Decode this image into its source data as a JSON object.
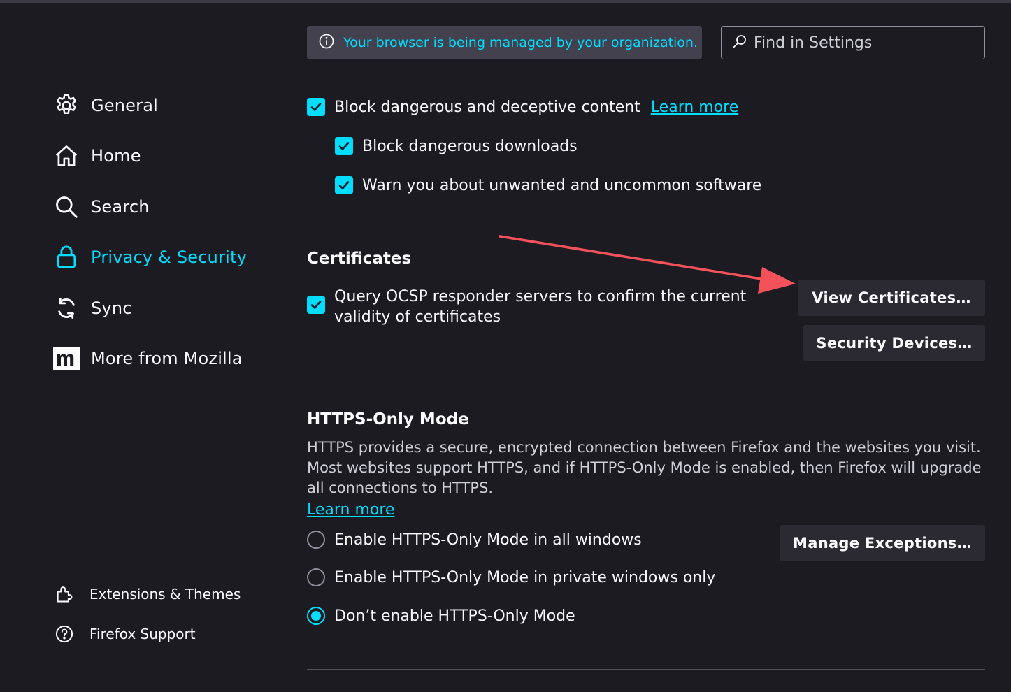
{
  "colors": {
    "background": "#1c1b22",
    "accent": "#00ddff",
    "button": "#2b2a33",
    "arrow": "#f4525a"
  },
  "sidebar": {
    "items": [
      {
        "label": "General",
        "icon": "gear-icon"
      },
      {
        "label": "Home",
        "icon": "home-icon"
      },
      {
        "label": "Search",
        "icon": "search-icon"
      },
      {
        "label": "Privacy & Security",
        "icon": "lock-icon",
        "active": true
      },
      {
        "label": "Sync",
        "icon": "sync-icon"
      },
      {
        "label": "More from Mozilla",
        "icon": "mozilla-icon"
      }
    ],
    "footer": [
      {
        "label": "Extensions & Themes",
        "icon": "puzzle-icon"
      },
      {
        "label": "Firefox Support",
        "icon": "help-icon"
      }
    ]
  },
  "header": {
    "managed_text": "Your browser is being managed by your organization.",
    "search_placeholder": "Find in Settings"
  },
  "deceptive": {
    "block_content": "Block dangerous and deceptive content",
    "learn_more": "Learn more",
    "block_downloads": "Block dangerous downloads",
    "warn_software": "Warn you about unwanted and uncommon software"
  },
  "certificates": {
    "heading": "Certificates",
    "ocsp_line1": "Query OCSP responder servers to confirm the current",
    "ocsp_line2": "validity of certificates",
    "view_button": "View Certificates…",
    "devices_button": "Security Devices…"
  },
  "https_only": {
    "heading": "HTTPS-Only Mode",
    "description": "HTTPS provides a secure, encrypted connection between Firefox and the websites you visit. Most websites support HTTPS, and if HTTPS-Only Mode is enabled, then Firefox will upgrade all connections to HTTPS.",
    "learn_more": "Learn more",
    "manage_button": "Manage Exceptions…",
    "options": [
      {
        "label": "Enable HTTPS-Only Mode in all windows",
        "selected": false
      },
      {
        "label": "Enable HTTPS-Only Mode in private windows only",
        "selected": false
      },
      {
        "label": "Don’t enable HTTPS-Only Mode",
        "selected": true
      }
    ]
  }
}
